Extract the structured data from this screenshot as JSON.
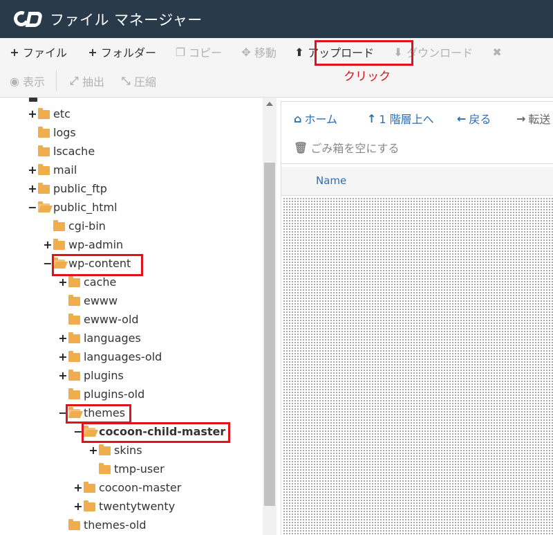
{
  "app": {
    "title": "ファイル マネージャー"
  },
  "colors": {
    "titlebar": "#293a4a",
    "highlight": "#e0121b",
    "link": "#2a6eb3",
    "folder": "#f0ad4e"
  },
  "toolbar": {
    "row1": [
      {
        "icon": "plus-icon",
        "glyph": "+",
        "label": "ファイル",
        "disabled": false
      },
      {
        "icon": "plus-icon",
        "glyph": "+",
        "label": "フォルダー",
        "disabled": false
      },
      {
        "icon": "copy-icon",
        "glyph": "❐",
        "label": "コピー",
        "disabled": true
      },
      {
        "icon": "move-icon",
        "glyph": "✥",
        "label": "移動",
        "disabled": true
      },
      {
        "icon": "upload-icon",
        "glyph": "⬆",
        "label": "アップロード",
        "disabled": false
      },
      {
        "icon": "download-icon",
        "glyph": "⬇",
        "label": "ダウンロード",
        "disabled": true
      },
      {
        "icon": "close-icon",
        "glyph": "✖",
        "label": "",
        "disabled": true
      }
    ],
    "row2": [
      {
        "icon": "eye-icon",
        "glyph": "◉",
        "label": "表示",
        "disabled": true
      },
      {
        "icon": "expand-icon",
        "glyph": "⤢",
        "label": "抽出",
        "disabled": true
      },
      {
        "icon": "compress-icon",
        "glyph": "⤡",
        "label": "圧縮",
        "disabled": true
      }
    ]
  },
  "annotation": {
    "label": "クリック"
  },
  "tree": {
    "items": [
      {
        "label": "etc",
        "toggle": "+",
        "level": 0,
        "open": false,
        "bold": false
      },
      {
        "label": "logs",
        "toggle": "",
        "level": 0,
        "open": false,
        "bold": false
      },
      {
        "label": "lscache",
        "toggle": "",
        "level": 0,
        "open": false,
        "bold": false
      },
      {
        "label": "mail",
        "toggle": "+",
        "level": 0,
        "open": false,
        "bold": false
      },
      {
        "label": "public_ftp",
        "toggle": "+",
        "level": 0,
        "open": false,
        "bold": false
      },
      {
        "label": "public_html",
        "toggle": "−",
        "level": 0,
        "open": true,
        "bold": false
      },
      {
        "label": "cgi-bin",
        "toggle": "",
        "level": 1,
        "open": false,
        "bold": false
      },
      {
        "label": "wp-admin",
        "toggle": "+",
        "level": 1,
        "open": false,
        "bold": false
      },
      {
        "label": "wp-content",
        "toggle": "−",
        "level": 1,
        "open": true,
        "bold": false
      },
      {
        "label": "cache",
        "toggle": "+",
        "level": 2,
        "open": false,
        "bold": false
      },
      {
        "label": "ewww",
        "toggle": "",
        "level": 2,
        "open": false,
        "bold": false
      },
      {
        "label": "ewww-old",
        "toggle": "",
        "level": 2,
        "open": false,
        "bold": false
      },
      {
        "label": "languages",
        "toggle": "+",
        "level": 2,
        "open": false,
        "bold": false
      },
      {
        "label": "languages-old",
        "toggle": "+",
        "level": 2,
        "open": false,
        "bold": false
      },
      {
        "label": "plugins",
        "toggle": "+",
        "level": 2,
        "open": false,
        "bold": false
      },
      {
        "label": "plugins-old",
        "toggle": "",
        "level": 2,
        "open": false,
        "bold": false
      },
      {
        "label": "themes",
        "toggle": "−",
        "level": 2,
        "open": true,
        "bold": false
      },
      {
        "label": "cocoon-child-master",
        "toggle": "−",
        "level": 3,
        "open": true,
        "bold": true
      },
      {
        "label": "skins",
        "toggle": "+",
        "level": 4,
        "open": false,
        "bold": false
      },
      {
        "label": "tmp-user",
        "toggle": "",
        "level": 4,
        "open": false,
        "bold": false
      },
      {
        "label": "cocoon-master",
        "toggle": "+",
        "level": 3,
        "open": false,
        "bold": false
      },
      {
        "label": "twentytwenty",
        "toggle": "+",
        "level": 3,
        "open": false,
        "bold": false
      },
      {
        "label": "themes-old",
        "toggle": "",
        "level": 2,
        "open": false,
        "bold": false
      }
    ]
  },
  "nav": {
    "home": "ホーム",
    "up": "1 階層上へ",
    "back": "戻る",
    "forward": "転送",
    "empty_trash": "ごみ箱を空にする"
  },
  "table": {
    "col_name": "Name"
  }
}
